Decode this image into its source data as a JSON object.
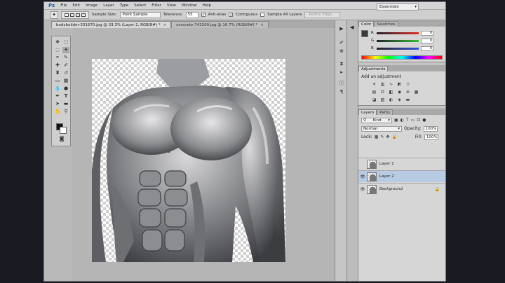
{
  "app": {
    "logo": "Ps"
  },
  "menu": [
    "File",
    "Edit",
    "Image",
    "Layer",
    "Type",
    "Select",
    "Filter",
    "View",
    "Window",
    "Help"
  ],
  "options": {
    "sample_size_label": "Sample Size:",
    "sample_size_value": "Point Sample",
    "tolerance_label": "Tolerance:",
    "tolerance_value": "55",
    "anti_alias_label": "Anti-alias",
    "contiguous_label": "Contiguous",
    "sample_all_layers_label": "Sample All Layers",
    "refine_edge_label": "Refine Edge...",
    "check_mark": "✓"
  },
  "workspace": {
    "value": "Essentials"
  },
  "document_tabs": [
    {
      "title": "bodybuilder-331670.jpg @ 33.3% (Layer 2, RGB/8#) *",
      "close": "×"
    },
    {
      "title": "concrete-743209.jpg @ 16.7% (RGB/8#) *",
      "close": "×"
    }
  ],
  "color_panel": {
    "tabs": [
      "Color",
      "Swatches"
    ],
    "sliders": [
      {
        "letter": "R",
        "value": "0"
      },
      {
        "letter": "G",
        "value": "0"
      },
      {
        "letter": "B",
        "value": "0"
      }
    ]
  },
  "adjustments_panel": {
    "tabs": [
      "Adjustments"
    ],
    "title": "Add an adjustment"
  },
  "layers_panel": {
    "tabs": [
      "Layers",
      "Paths"
    ],
    "kind_label": "Kind",
    "blend_mode": "Normal",
    "opacity_label": "Opacity:",
    "opacity_value": "100%",
    "lock_label": "Lock:",
    "fill_label": "Fill:",
    "fill_value": "100%",
    "layers": [
      {
        "name": "Layer 1",
        "visible": false,
        "selected": false,
        "italic": false
      },
      {
        "name": "Layer 2",
        "visible": true,
        "selected": true,
        "italic": false
      },
      {
        "name": "Background",
        "visible": true,
        "selected": false,
        "italic": true
      }
    ]
  },
  "colors": {
    "foreground": "#111111",
    "background": "#ffffff",
    "selection": "#b7cbe3"
  }
}
